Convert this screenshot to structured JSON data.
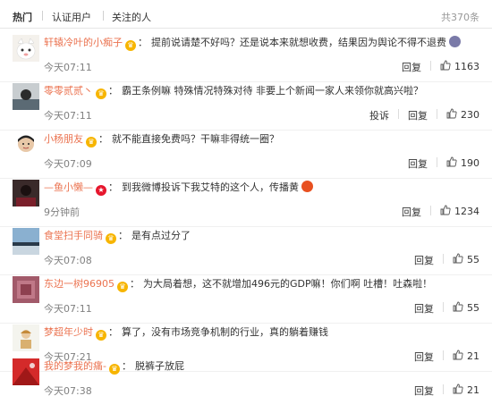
{
  "tabs": {
    "hot": "热门",
    "verified": "认证用户",
    "following": "关注的人",
    "total": "共370条"
  },
  "labels": {
    "reply": "回复",
    "report": "投诉"
  },
  "colors": {
    "username": "#eb7350",
    "timestamp": "#808080",
    "text": "#333333"
  },
  "comments": [
    {
      "user": "轩辕冷叶的小痴子",
      "badge": "vip-crown-icon",
      "text": "提前说请楚不好吗？还是说本来就想收费，结果因为舆论不得不退费",
      "emoji": "crying-face-icon",
      "time": "今天07:11",
      "likes": "1163",
      "show_report": false
    },
    {
      "user": "零零贰贰丶",
      "badge": "vip-crown-icon",
      "text": "霸王条例嘛 特殊情况特殊对待 非要上个新闻一家人来领你就高兴啦？",
      "emoji": "",
      "time": "今天07:11",
      "likes": "230",
      "show_report": true
    },
    {
      "user": "小杨朋友",
      "badge": "vip-crown-icon",
      "text": "就不能直接免费吗？干嘛非得统一圈？",
      "emoji": "",
      "time": "今天07:09",
      "likes": "190",
      "show_report": false
    },
    {
      "user": "—鱼小懒—",
      "badge": "red-star-icon",
      "text": "到我微博投诉下我艾特的这个人，传播黄",
      "emoji": "red-face-icon",
      "time": "9分钟前",
      "likes": "1234",
      "show_report": false
    },
    {
      "user": "食堂扫手同骑",
      "badge": "vip-crown-icon",
      "text": "是有点过分了",
      "emoji": "",
      "time": "今天07:08",
      "likes": "55",
      "show_report": false
    },
    {
      "user": "东边一树96905",
      "badge": "vip-crown-icon",
      "text": "为大局着想，这不就增加496元的GDP嘛！你们啊 吐槽！吐森啦！",
      "emoji": "",
      "time": "今天07:11",
      "likes": "55",
      "show_report": false
    },
    {
      "user": "梦超年少时",
      "badge": "vip-crown-icon",
      "text": "算了，没有市场竞争机制的行业，真的躺着赚钱",
      "emoji": "",
      "time": "今天07:21",
      "likes": "21",
      "show_report": false
    },
    {
      "user": "我的梦我的痛-",
      "badge": "vip-crown-icon",
      "text": "脱裤子放屁",
      "emoji": "",
      "time": "今天07:38",
      "likes": "21",
      "show_report": false
    }
  ]
}
